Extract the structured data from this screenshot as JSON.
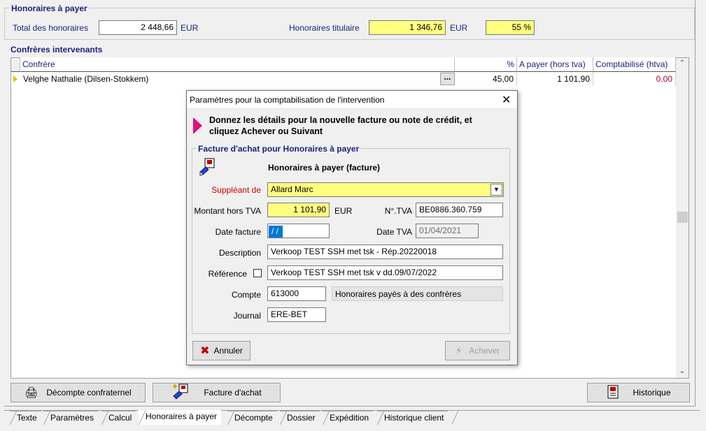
{
  "fees_section": {
    "title": "Honoraires à payer",
    "total_label": "Total des honoraires",
    "total_value": "2 448,66",
    "total_currency": "EUR",
    "holder_label": "Honoraires titulaire",
    "holder_value": "1 346,76",
    "holder_currency": "EUR",
    "holder_percent": "55 %"
  },
  "colleagues": {
    "title": "Confrères intervenants",
    "columns": [
      "Confrère",
      "%",
      "A payer (hors tva)",
      "Comptabilisé (htva)"
    ],
    "rows": [
      {
        "name": "Velghe Nathalie (Dilsen-Stokkem)",
        "ellipsis": "...",
        "percent": "45,00",
        "to_pay": "1 101,90",
        "booked": "0,00"
      }
    ]
  },
  "dialog": {
    "title": "Paramètres pour la comptabilisation de l'intervention",
    "instruction_line1": "Donnez les détails pour la nouvelle facture ou note de crédit, et",
    "instruction_line2": "cliquez Achever ou Suivant",
    "group_title": "Facture d'achat pour Honoraires à payer",
    "subtitle": "Honoraires à payer (facture)",
    "substitute_label": "Suppléant de",
    "substitute_value": "Allard Marc",
    "amount_label": "Montant hors TVA",
    "amount_value": "1 101,90",
    "amount_currency": "EUR",
    "vat_no_label": "N°.TVA",
    "vat_no_value": "BE0886.360.759",
    "invoice_date_label": "Date facture",
    "invoice_date_value": " /  /",
    "vat_date_label": "Date TVA",
    "vat_date_value": "01/04/2021",
    "description_label": "Description",
    "description_value": "Verkoop TEST SSH met tsk  - Rép.20220018",
    "reference_label": "Référence",
    "reference_value": "Verkoop TEST SSH met tsk v dd.09/07/2022",
    "account_label": "Compte",
    "account_value": "613000",
    "account_desc": "Honoraires payés à des confrères",
    "journal_label": "Journal",
    "journal_value": "ERE-BET",
    "cancel_label": "Annuler",
    "finish_label": "Achever"
  },
  "bottom_buttons": {
    "statement_label": "Décompte confraternel",
    "purchase_label": "Facture d'achat",
    "history_label": "Historique"
  },
  "tabs": [
    "Texte",
    "Paramètres",
    "Calcul",
    "Honoraires à payer",
    "Décompte",
    "Dossier",
    "Expédition",
    "Historique client"
  ],
  "colors": {
    "label_navy": "#1a237e",
    "highlight_yellow": "#ffff80",
    "required_red": "#d00000",
    "booked_red": "#b00020"
  }
}
